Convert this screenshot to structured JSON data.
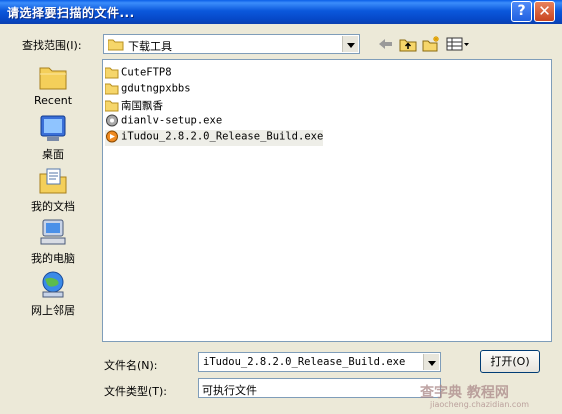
{
  "window": {
    "title": "请选择要扫描的文件..."
  },
  "titlebar": {
    "help_label": "?",
    "close_label": "✕"
  },
  "lookin": {
    "label": "查找范围(I):",
    "value": "下载工具"
  },
  "places": [
    {
      "label": "Recent",
      "icon": "recent-folder-icon"
    },
    {
      "label": "桌面",
      "icon": "desktop-icon"
    },
    {
      "label": "我的文档",
      "icon": "my-documents-icon"
    },
    {
      "label": "我的电脑",
      "icon": "my-computer-icon"
    },
    {
      "label": "网上邻居",
      "icon": "network-places-icon"
    }
  ],
  "files": [
    {
      "name": "CuteFTP8",
      "icon": "folder-icon"
    },
    {
      "name": "gdutngpxbbs",
      "icon": "folder-icon"
    },
    {
      "name": "南国飘香",
      "icon": "folder-icon"
    },
    {
      "name": "dianlv-setup.exe",
      "icon": "setup-exe-icon"
    },
    {
      "name": "iTudou_2.8.2.0_Release_Build.exe",
      "icon": "tudou-exe-icon"
    }
  ],
  "filename": {
    "label": "文件名(N):",
    "value": "iTudou_2.8.2.0_Release_Build.exe"
  },
  "filetype": {
    "label": "文件类型(T):",
    "value": "可执行文件"
  },
  "buttons": {
    "open": "打开(O)"
  },
  "watermark": {
    "text": "查字典 教程网",
    "sub": "jiaocheng.chazidian.com"
  }
}
